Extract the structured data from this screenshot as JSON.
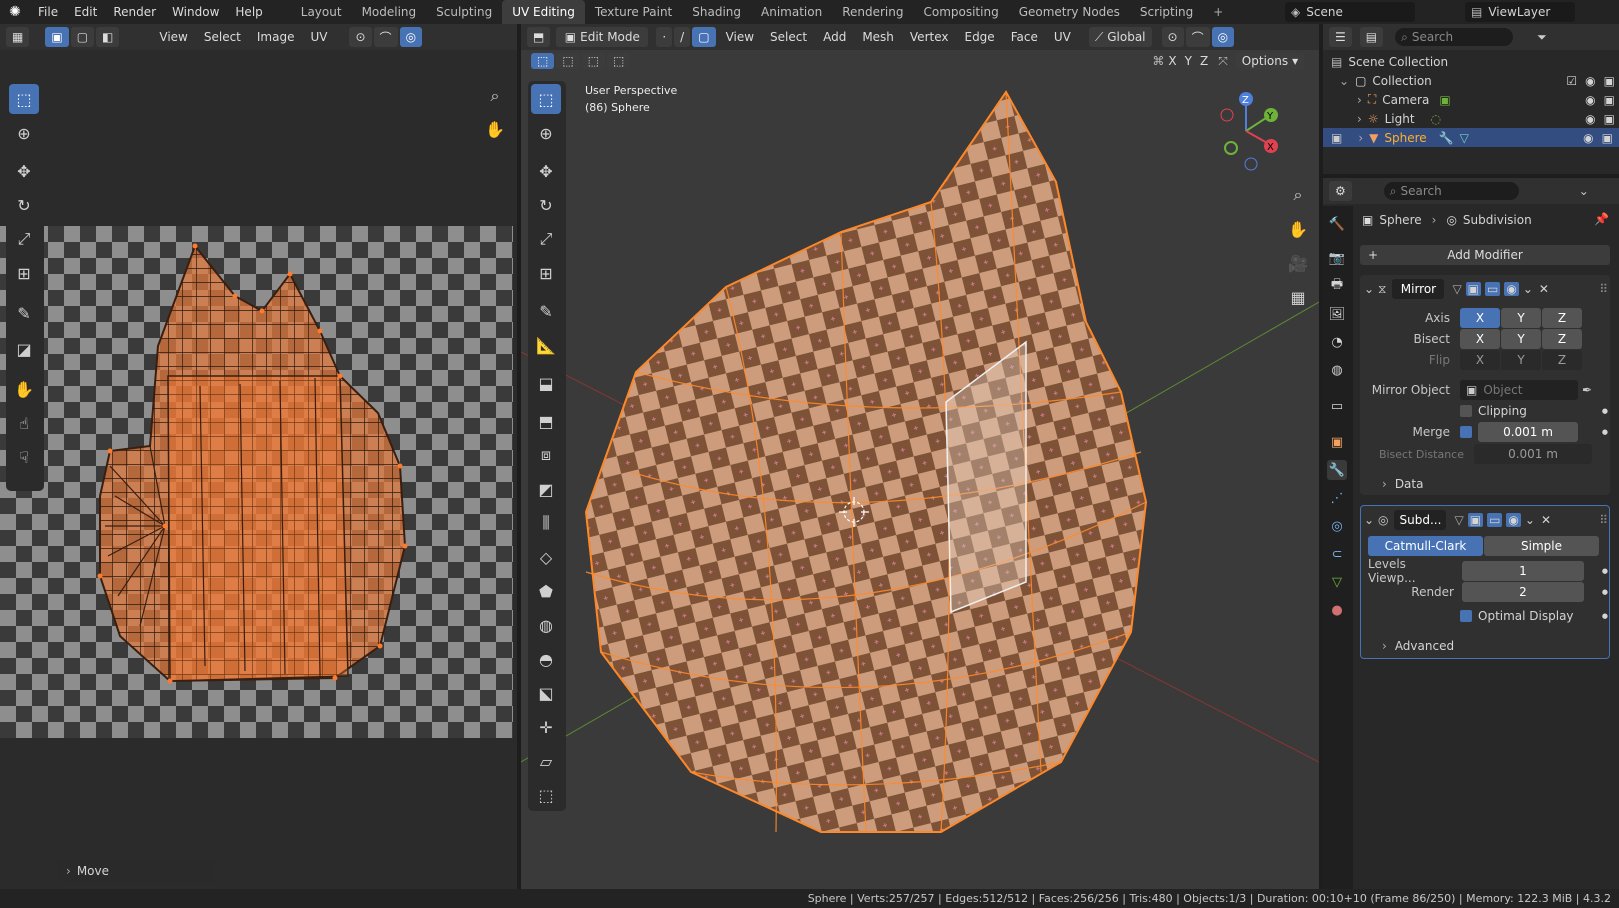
{
  "menu": [
    "File",
    "Edit",
    "Render",
    "Window",
    "Help"
  ],
  "workspaces": [
    "Layout",
    "Modeling",
    "Sculpting",
    "UV Editing",
    "Texture Paint",
    "Shading",
    "Animation",
    "Rendering",
    "Compositing",
    "Geometry Nodes",
    "Scripting"
  ],
  "active_workspace": "UV Editing",
  "scene": "Scene",
  "view_layer": "ViewLayer",
  "uv_editor": {
    "menus": [
      "View",
      "Select",
      "Image",
      "UV"
    ],
    "move_panel": "Move"
  },
  "viewport": {
    "mode": "Edit Mode",
    "menus": [
      "View",
      "Select",
      "Add",
      "Mesh",
      "Vertex",
      "Edge",
      "Face",
      "UV"
    ],
    "orientation": "Global",
    "options": "Options",
    "axis_x": "X",
    "axis_y": "Y",
    "axis_z": "Z",
    "overlay_title": "User Perspective",
    "overlay_object": "(86) Sphere"
  },
  "outliner": {
    "search": "Search",
    "scene_collection": "Scene Collection",
    "collection": "Collection",
    "items": [
      "Camera",
      "Light",
      "Sphere"
    ]
  },
  "properties": {
    "search": "Search",
    "breadcrumb_object": "Sphere",
    "breadcrumb_modifier": "Subdivision",
    "add_modifier": "Add Modifier",
    "mirror": {
      "name": "Mirror",
      "axis_label": "Axis",
      "bisect_label": "Bisect",
      "flip_label": "Flip",
      "x": "X",
      "y": "Y",
      "z": "Z",
      "mirror_object_label": "Mirror Object",
      "mirror_object_placeholder": "Object",
      "clipping": "Clipping",
      "merge_label": "Merge",
      "merge_value": "0.001 m",
      "bisect_distance_label": "Bisect Distance",
      "bisect_distance_value": "0.001 m",
      "data": "Data"
    },
    "subdiv": {
      "name": "Subd...",
      "catmull": "Catmull-Clark",
      "simple": "Simple",
      "levels_label": "Levels Viewp...",
      "levels_value": "1",
      "render_label": "Render",
      "render_value": "2",
      "optimal": "Optimal Display",
      "advanced": "Advanced"
    }
  },
  "status": "Sphere | Verts:257/257 | Edges:512/512 | Faces:256/256 | Tris:480 | Objects:1/3 | Duration: 00:10+10 (Frame 86/250) | Memory: 122.3 MiB | 4.3.2",
  "colors": {
    "accent": "#4772b3",
    "selection": "#ff8a2a",
    "background": "#1d1d1d"
  }
}
